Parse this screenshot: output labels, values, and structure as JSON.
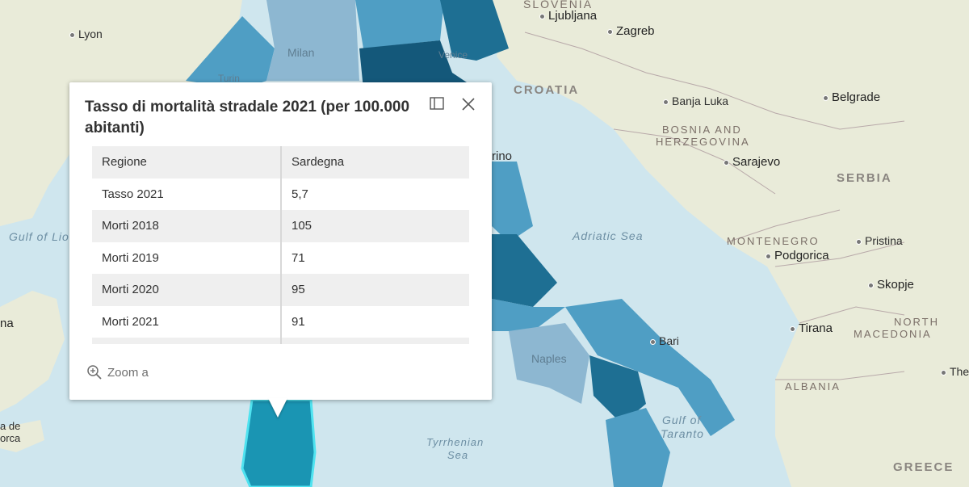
{
  "popup": {
    "title": "Tasso di mortalità  stradale 2021 (per 100.000 abitanti)",
    "dock_icon": "dock-icon",
    "close_icon": "close-icon",
    "rows": [
      {
        "key": "Regione",
        "value": "Sardegna"
      },
      {
        "key": "Tasso 2021",
        "value": "5,7"
      },
      {
        "key": "Morti 2018",
        "value": "105"
      },
      {
        "key": "Morti 2019",
        "value": "71"
      },
      {
        "key": "Morti 2020",
        "value": "95"
      },
      {
        "key": "Morti 2021",
        "value": "91"
      },
      {
        "key": "",
        "value": ""
      }
    ],
    "zoom_label": "Zoom a",
    "zoom_icon": "zoom-in-icon"
  },
  "map": {
    "colors": {
      "sea": "#cfe6ee",
      "land": "#e9ebd9",
      "region_light": "#8db7d1",
      "region_mid": "#4f9ec4",
      "region_dark": "#1e6f93",
      "region_darkest": "#14587a",
      "region_selected": "#1a95b3",
      "selection_outline": "#4fe3f0"
    },
    "labels": {
      "slovenia": "SLOVENIA",
      "ljubljana": "Ljubljana",
      "zagreb": "Zagreb",
      "lyon": "Lyon",
      "milan": "Milan",
      "venice": "Venice",
      "turin": "Turin",
      "croatia": "CROATIA",
      "banja_luka": "Banja Luka",
      "belgrade": "Belgrade",
      "bosnia": "BOSNIA AND",
      "herzegovina": "HERZEGOVINA",
      "sarajevo": "Sarajevo",
      "serbia": "SERBIA",
      "rino": "rino",
      "gulf_lion": "Gulf of Lio",
      "adriatic": "Adriatic Sea",
      "montenegro": "MONTENEGRO",
      "pristina": "Pristina",
      "podgorica": "Podgorica",
      "skopje": "Skopje",
      "ana": "na",
      "tirana": "Tirana",
      "north": "NORTH",
      "macedonia": "MACEDONIA",
      "bari": "Bari",
      "naples": "Naples",
      "albania": "ALBANIA",
      "the": "The",
      "gulf_of": "Gulf of",
      "taranto": "Taranto",
      "tyrrhenian": "Tyrrhenian",
      "sea": "Sea",
      "ade": "a de",
      "orca": "orca",
      "greece": "GREECE"
    }
  }
}
